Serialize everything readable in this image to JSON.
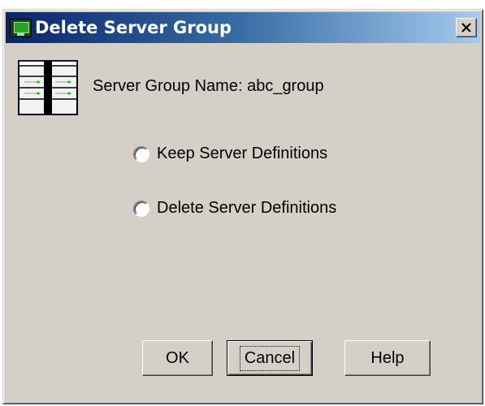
{
  "window": {
    "title": "Delete Server Group",
    "close_label": "×"
  },
  "content": {
    "group_label": "Server Group Name: abc_group"
  },
  "options": [
    {
      "label": "Keep Server Definitions",
      "selected": false
    },
    {
      "label": "Delete Server Definitions",
      "selected": false
    }
  ],
  "buttons": {
    "ok": "OK",
    "cancel": "Cancel",
    "help": "Help"
  },
  "colors": {
    "titlebar_start": "#0a246a",
    "titlebar_end": "#a6caf0",
    "dialog_bg": "#d4d0c8"
  },
  "icons": {
    "app": "app-monitor-icon",
    "server_group": "server-group-icon",
    "close": "close-icon"
  }
}
